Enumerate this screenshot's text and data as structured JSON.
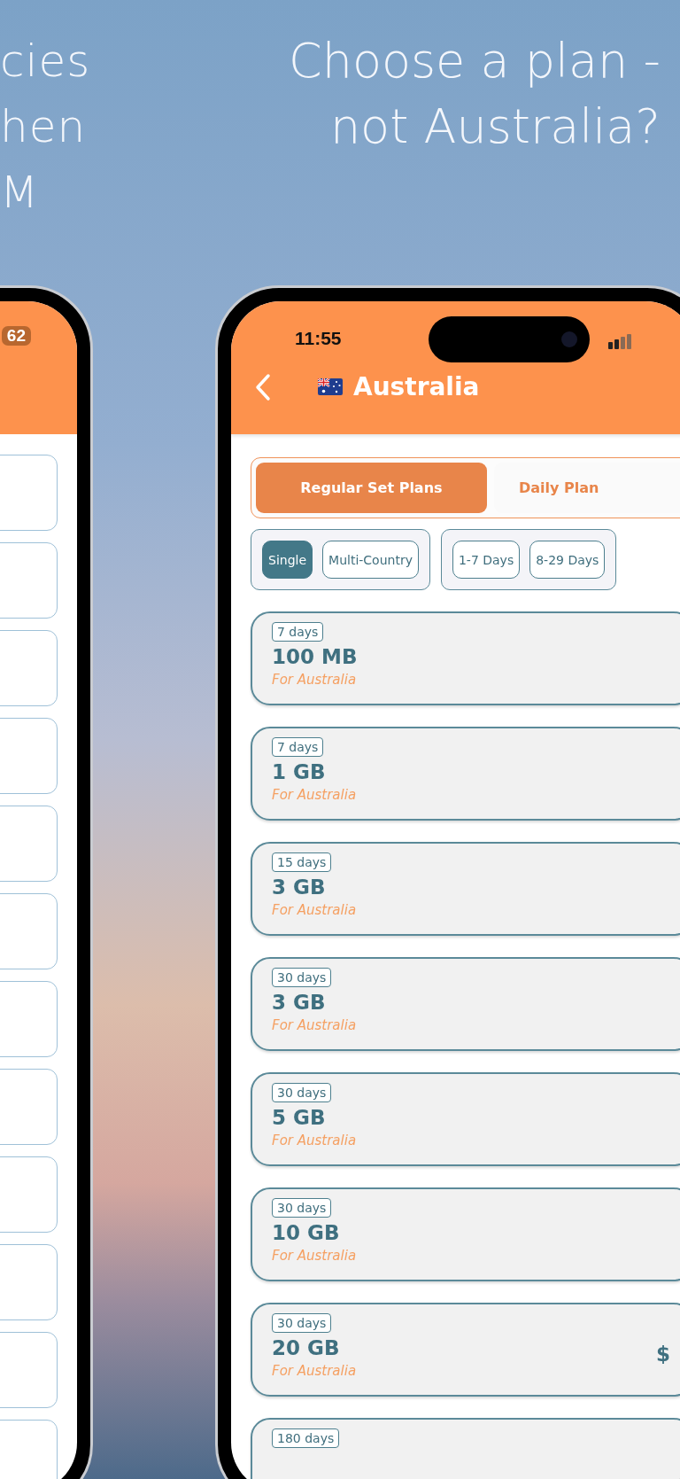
{
  "headlines": [
    {
      "lines": [
        "cies",
        "hen",
        "M"
      ]
    },
    {
      "lines": [
        "Choose a plan -",
        "not Australia?"
      ]
    }
  ],
  "left_phone": {
    "status_bar": {
      "battery": "62"
    }
  },
  "phone": {
    "status_bar": {
      "time": "11:55"
    },
    "header": {
      "title": "Australia"
    },
    "plan_tabs": [
      {
        "label": "Regular Set Plans",
        "selected": true
      },
      {
        "label": "Daily Plan",
        "selected": false
      }
    ],
    "filter_groups": [
      [
        {
          "label": "Single",
          "selected": true
        },
        {
          "label": "Multi-Country",
          "selected": false
        }
      ],
      [
        {
          "label": "1-7 Days",
          "selected": false
        },
        {
          "label": "8-29 Days",
          "selected": false
        }
      ]
    ],
    "plans": [
      {
        "duration": "7 days",
        "data": "100 MB",
        "region": "For Australia"
      },
      {
        "duration": "7 days",
        "data": "1 GB",
        "region": "For Australia"
      },
      {
        "duration": "15 days",
        "data": "3 GB",
        "region": "For Australia"
      },
      {
        "duration": "30 days",
        "data": "3 GB",
        "region": "For Australia"
      },
      {
        "duration": "30 days",
        "data": "5 GB",
        "region": "For Australia"
      },
      {
        "duration": "30 days",
        "data": "10 GB",
        "region": "For Australia"
      },
      {
        "duration": "30 days",
        "data": "20 GB",
        "region": "For Australia",
        "price": "$"
      },
      {
        "duration": "180 days"
      }
    ]
  }
}
